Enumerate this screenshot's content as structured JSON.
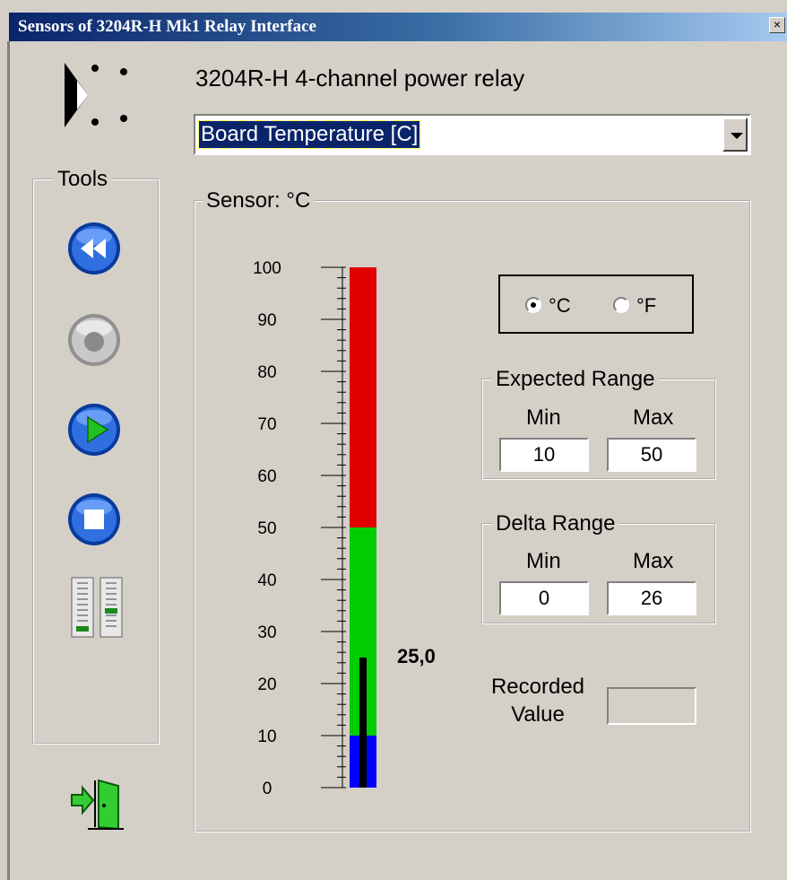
{
  "window": {
    "title": "Sensors of 3204R-H Mk1 Relay  Interface",
    "close_glyph": "×"
  },
  "header": {
    "device_name": "3204R-H  4-channel power relay"
  },
  "sensor_select": {
    "selected": "Board Temperature [C]"
  },
  "tools": {
    "legend": "Tools",
    "buttons": [
      {
        "name": "rewind-icon"
      },
      {
        "name": "record-icon-disabled"
      },
      {
        "name": "play-icon"
      },
      {
        "name": "stop-icon"
      },
      {
        "name": "meters-icon"
      }
    ]
  },
  "sensor": {
    "legend": "Sensor: °C",
    "scale_labels": [
      "100",
      "90",
      "80",
      "70",
      "60",
      "50",
      "40",
      "30",
      "20",
      "10",
      "0"
    ],
    "reading_label": "25,0",
    "current_value": 25,
    "scale_min": 0,
    "scale_max": 100,
    "bands": [
      {
        "from": 0,
        "to": 10,
        "color": "#0000ff"
      },
      {
        "from": 10,
        "to": 50,
        "color": "#00cc00"
      },
      {
        "from": 50,
        "to": 100,
        "color": "#e00000"
      }
    ]
  },
  "units": {
    "celsius": "°C",
    "fahrenheit": "°F",
    "selected": "celsius"
  },
  "expected_range": {
    "legend": "Expected Range",
    "min_label": "Min",
    "max_label": "Max",
    "min": "10",
    "max": "50"
  },
  "delta_range": {
    "legend": "Delta Range",
    "min_label": "Min",
    "max_label": "Max",
    "min": "0",
    "max": "26"
  },
  "recorded": {
    "label_line1": "Recorded",
    "label_line2": "Value",
    "value": ""
  }
}
